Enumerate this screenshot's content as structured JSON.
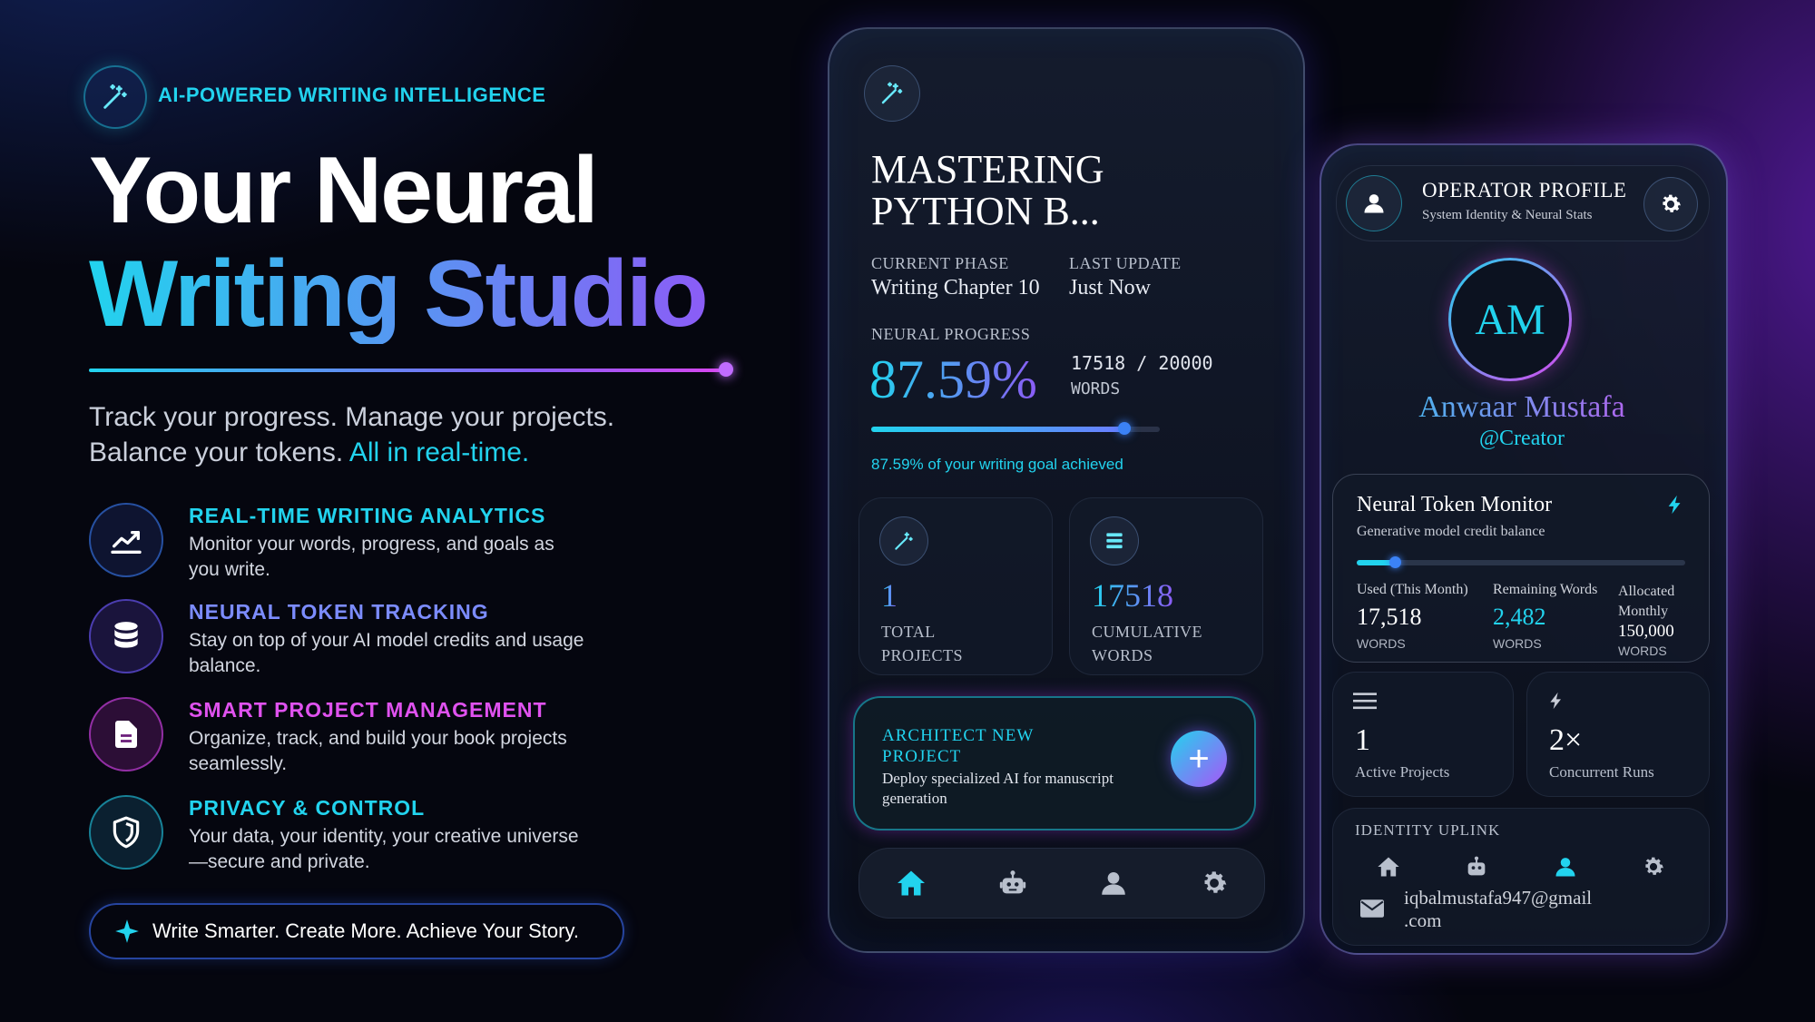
{
  "hero": {
    "badge": "AI-POWERED WRITING INTELLIGENCE",
    "title_line1": "Your Neural",
    "title_line2": "Writing Studio",
    "tagline_line1": "Track your progress. Manage your projects.",
    "tagline_line2a": "Balance your tokens.",
    "tagline_line2b": "All in real-time."
  },
  "features": [
    {
      "title": "REAL-TIME WRITING ANALYTICS",
      "desc": "Monitor your words, progress, and goals as you write.",
      "icon": "chart-icon",
      "color": "#22d3ee"
    },
    {
      "title": "NEURAL TOKEN TRACKING",
      "desc": "Stay on top of your AI model credits and usage balance.",
      "icon": "database-icon",
      "color": "#6b7cff"
    },
    {
      "title": "SMART PROJECT MANAGEMENT",
      "desc": "Organize, track, and build your book projects seamlessly.",
      "icon": "document-icon",
      "color": "#d946ef"
    },
    {
      "title": "PRIVACY & CONTROL",
      "desc": "Your data, your identity, your creative universe—secure and private.",
      "icon": "shield-icon",
      "color": "#22d3ee"
    }
  ],
  "cta": {
    "text": "Write Smarter. Create More. Achieve Your Story."
  },
  "project": {
    "title_line1": "MASTERING",
    "title_line2": "PYTHON B...",
    "phase_label": "CURRENT PHASE",
    "phase_value": "Writing Chapter 10",
    "update_label": "LAST UPDATE",
    "update_value": "Just Now",
    "progress_label": "NEURAL PROGRESS",
    "progress_percent": "87.59%",
    "progress_fraction": 0.8759,
    "words_count": "17518 / 20000",
    "words_unit": "WORDS",
    "goal_text": "87.59% of your writing goal achieved",
    "stat1_value": "1",
    "stat1_label_l1": "TOTAL",
    "stat1_label_l2": "PROJECTS",
    "stat2_value": "17518",
    "stat2_label_l1": "CUMULATIVE",
    "stat2_label_l2": "WORDS",
    "new_title_l1": "ARCHITECT NEW",
    "new_title_l2": "PROJECT",
    "new_desc": "Deploy specialized AI for manuscript generation",
    "new_button": "+"
  },
  "profile": {
    "header_title": "OPERATOR PROFILE",
    "header_sub": "System Identity & Neural Stats",
    "initials": "AM",
    "name": "Anwaar Mustafa",
    "handle": "@Creator",
    "token_title": "Neural Token Monitor",
    "token_sub": "Generative model credit balance",
    "token_fraction": 0.117,
    "used_label": "Used (This Month)",
    "used_value": "17,518",
    "used_unit": "WORDS",
    "remaining_label": "Remaining Words",
    "remaining_value": "2,482",
    "remaining_unit": "WORDS",
    "allocated_label_l1": "Allocated",
    "allocated_label_l2": "Monthly",
    "allocated_value": "150,000",
    "allocated_unit": "WORDS",
    "active_value": "1",
    "active_label": "Active Projects",
    "concurrent_value": "2×",
    "concurrent_label": "Concurrent Runs",
    "uplink_label": "IDENTITY UPLINK",
    "email_l1": "iqbalmustafa947@gmail",
    "email_l2": ".com"
  },
  "colors": {
    "accent_cyan": "#22d3ee",
    "accent_purple": "#8b5cf6",
    "accent_magenta": "#d946ef"
  }
}
